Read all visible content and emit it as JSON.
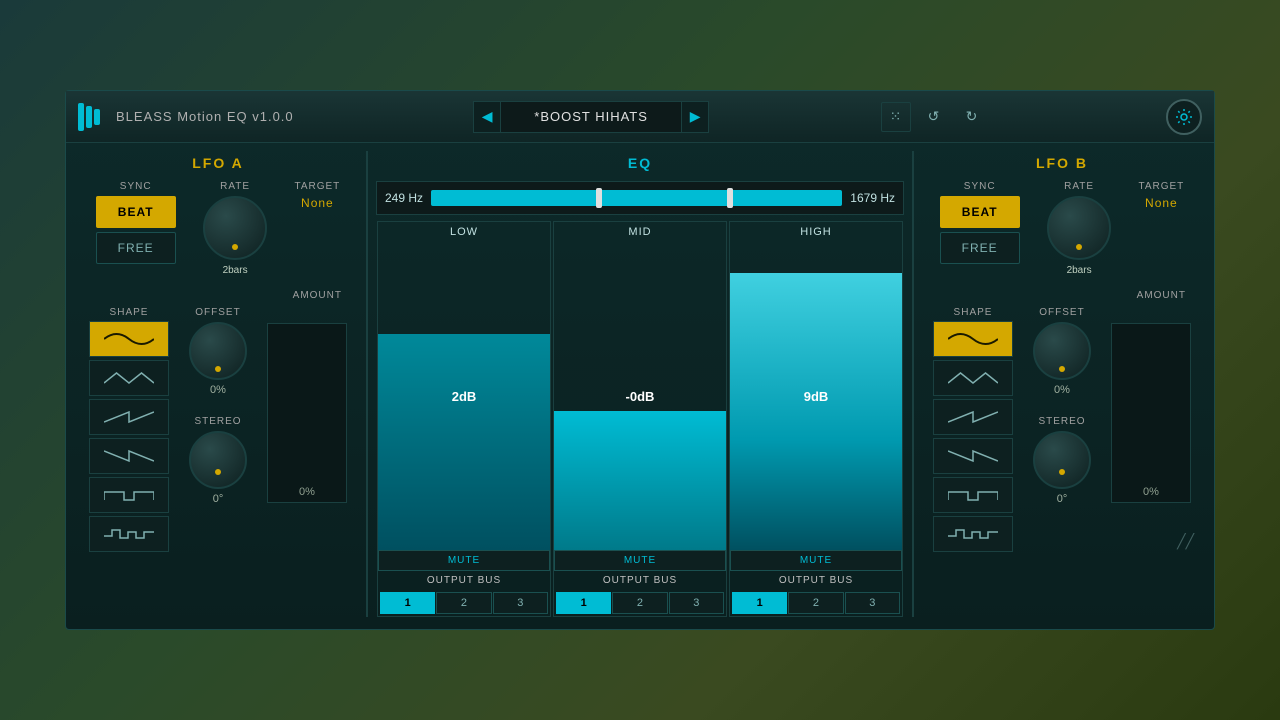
{
  "header": {
    "logo_alt": "BLEASS Logo",
    "title": "BLEASS Motion EQ  v1.0.0",
    "preset_name": "*BOOST HIHATS",
    "nav_prev": "◀",
    "nav_next": "▶",
    "icon_grid": "⁙",
    "icon_undo": "↺",
    "icon_redo": "↻"
  },
  "lfo_a": {
    "title": "LFO A",
    "sync_label": "SYNC",
    "rate_label": "RATE",
    "target_label": "TARGET",
    "beat_label": "BEAT",
    "free_label": "FREE",
    "rate_value": "2bars",
    "target_value": "None",
    "amount_label": "AMOUNT",
    "amount_value": "0%",
    "shape_label": "SHAPE",
    "offset_label": "OFFSET",
    "offset_value": "0%",
    "stereo_label": "STEREO",
    "stereo_value": "0°"
  },
  "eq": {
    "title": "EQ",
    "freq_low": "249 Hz",
    "freq_high": "1679 Hz",
    "bands": [
      {
        "label": "LOW",
        "db": "2dB",
        "mute": "MUTE",
        "output_bus": "OUTPUT BUS",
        "bus_active": 1,
        "bus_options": [
          "1",
          "2",
          "3"
        ]
      },
      {
        "label": "MID",
        "db": "-0dB",
        "mute": "MUTE",
        "output_bus": "OUTPUT BUS",
        "bus_active": 1,
        "bus_options": [
          "1",
          "2",
          "3"
        ]
      },
      {
        "label": "HIGH",
        "db": "9dB",
        "mute": "MUTE",
        "output_bus": "OUTPUT BUS",
        "bus_active": 1,
        "bus_options": [
          "1",
          "2",
          "3"
        ]
      }
    ]
  },
  "lfo_b": {
    "title": "LFO B",
    "sync_label": "SYNC",
    "rate_label": "RATE",
    "target_label": "TARGET",
    "beat_label": "BEAT",
    "free_label": "FREE",
    "rate_value": "2bars",
    "target_value": "None",
    "amount_label": "AMOUNT",
    "amount_value": "0%",
    "shape_label": "SHAPE",
    "offset_label": "OFFSET",
    "offset_value": "0%",
    "stereo_label": "STEREO",
    "stereo_value": "0°"
  }
}
